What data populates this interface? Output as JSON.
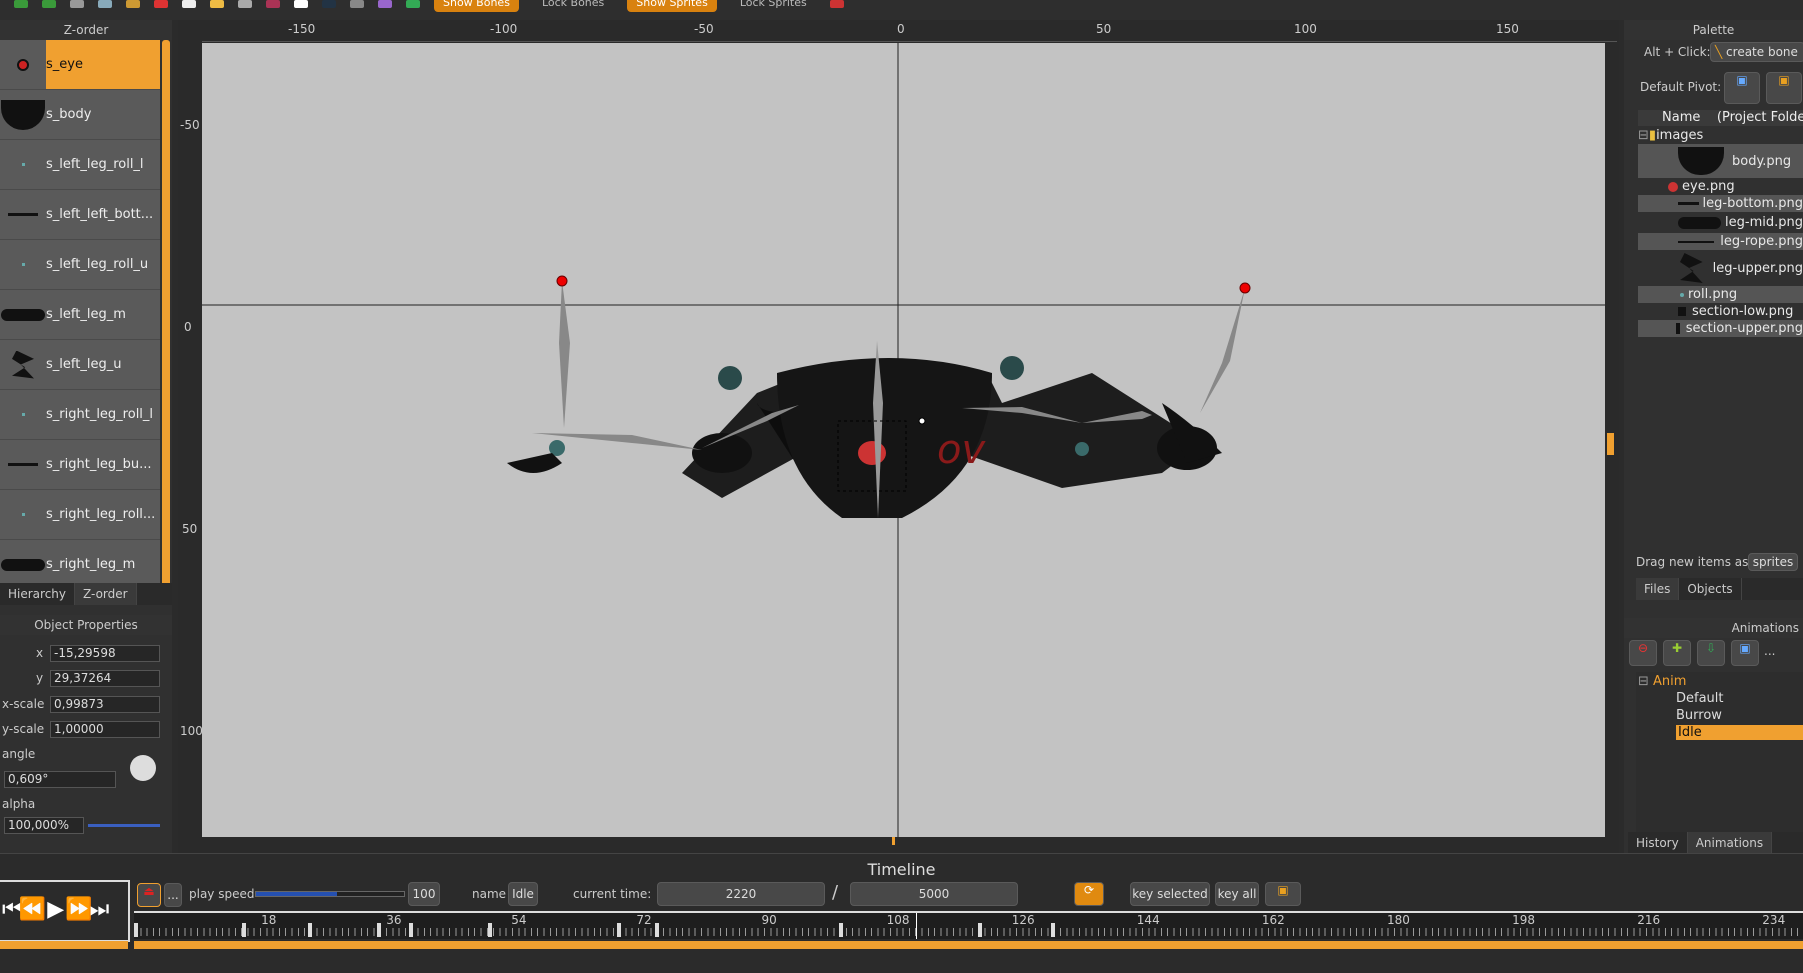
{
  "toolbar": {
    "show_bones": "Show Bones",
    "lock_bones": "Lock Bones",
    "show_sprites": "Show Sprites",
    "lock_sprites": "Lock Sprites"
  },
  "zorder": {
    "title": "Z-order",
    "items": [
      {
        "label": "s_eye"
      },
      {
        "label": "s_body"
      },
      {
        "label": "s_left_leg_roll_l"
      },
      {
        "label": "s_left_left_bott..."
      },
      {
        "label": "s_left_leg_roll_u"
      },
      {
        "label": "s_left_leg_m"
      },
      {
        "label": "s_left_leg_u"
      },
      {
        "label": "s_right_leg_roll_l"
      },
      {
        "label": "s_right_leg_bu..."
      },
      {
        "label": "s_right_leg_roll..."
      },
      {
        "label": "s_right_leg_m"
      }
    ],
    "tabs": [
      "Hierarchy",
      "Z-order"
    ]
  },
  "properties": {
    "title": "Object Properties",
    "x_label": "x",
    "x": "-15,29598",
    "y_label": "y",
    "y": "29,37264",
    "xscale_label": "x-scale",
    "xscale": "0,99873",
    "yscale_label": "y-scale",
    "yscale": "1,00000",
    "angle_label": "angle",
    "angle": "0,609°",
    "alpha_label": "alpha",
    "alpha": "100,000%"
  },
  "ruler": {
    "h": [
      "-150",
      "-100",
      "-50",
      "0",
      "50",
      "100",
      "150"
    ],
    "v": [
      "-50",
      "0",
      "50",
      "100"
    ]
  },
  "palette": {
    "title": "Palette",
    "alt_click": "Alt + Click:",
    "create_bone": "create bone",
    "default_pivot": "Default Pivot:",
    "col_name": "Name",
    "col_folder": "(Project Folder)",
    "folder": "images",
    "files": [
      "body.png",
      "eye.png",
      "leg-bottom.png",
      "leg-mid.png",
      "leg-rope.png",
      "leg-upper.png",
      "roll.png",
      "section-low.png",
      "section-upper.png"
    ],
    "drag_label": "Drag new items as",
    "drag_value": "sprites",
    "tabs": [
      "Files",
      "Objects"
    ]
  },
  "animations": {
    "title": "Animations",
    "root": "Anim",
    "items": [
      "Default",
      "Burrow",
      "Idle"
    ],
    "selected": "Idle",
    "tabs": [
      "History",
      "Animations"
    ]
  },
  "timeline": {
    "title": "Timeline",
    "play_speed_label": "play speed",
    "play_speed": "100",
    "play_speed_fraction": 0.55,
    "name_label": "name",
    "name": "Idle",
    "current_time_label": "current time:",
    "current_time": "2220",
    "sep": "/",
    "total_time": "5000",
    "key_selected": "key selected",
    "key_all": "key all",
    "more": "...",
    "ticks": [
      "18",
      "36",
      "54",
      "72",
      "90",
      "108",
      "126",
      "144",
      "162",
      "180",
      "198",
      "216",
      "234"
    ]
  },
  "colors": {
    "accent": "#f0a030",
    "stage": "#c3c3c3"
  }
}
